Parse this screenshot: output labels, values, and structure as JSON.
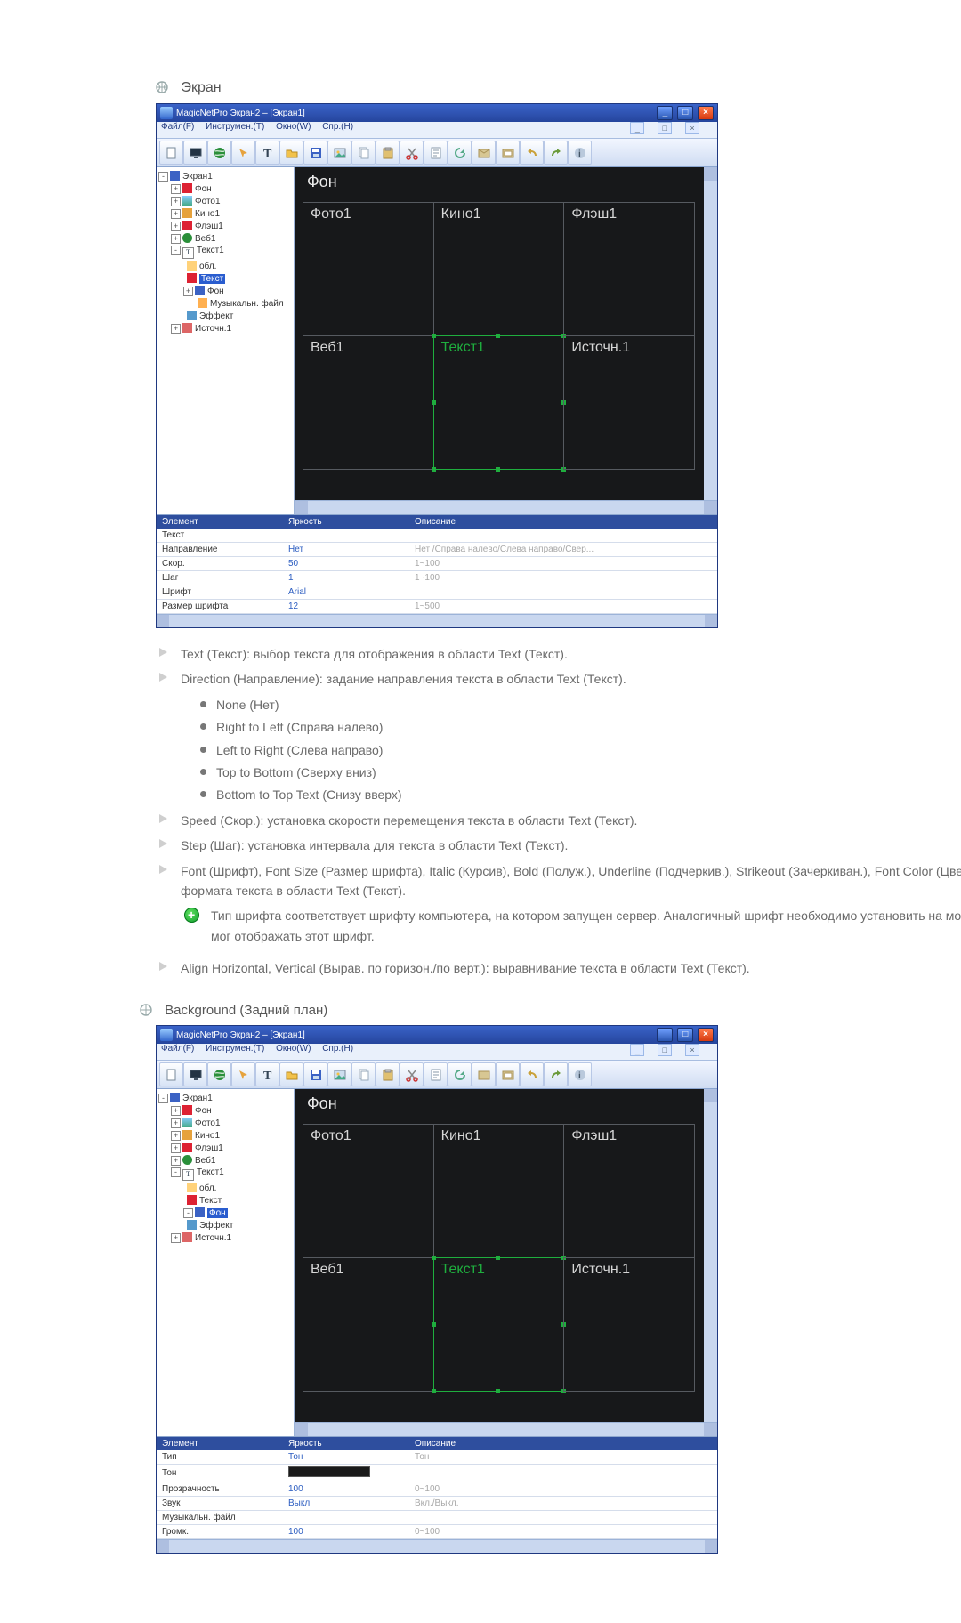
{
  "sections": {
    "screen_heading": "Экран",
    "background_heading": "Background (Задний план)"
  },
  "doc": {
    "text_item": "Text (Текст): выбор текста для отображения в области Text (Текст).",
    "direction_item": "Direction (Направление): задание направления текста в области Text (Текст).",
    "direction_opts": [
      "None (Нет)",
      "Right to Left (Справа налево)",
      "Left to Right (Слева направо)",
      "Top to Bottom (Сверху вниз)",
      "Bottom to Top Text (Снизу вверх)"
    ],
    "speed_item": "Speed (Скор.): установка скорости перемещения текста в области Text (Текст).",
    "step_item": "Step (Шаг): установка интервала для текста в области Text (Текст).",
    "font_item": "Font (Шрифт), Font Size (Размер шрифта), Italic (Курсив), Bold (Полуж.), Underline (Подчеркив.), Strikeout (Зачеркиван.), Font Color (Цвет шрифта): задание формата текста в области Text (Текст).",
    "font_note": "Тип шрифта соответствует шрифту компьютера, на котором запущен сервер. Аналогичный шрифт необходимо установить на мониторе, чтобы он мог отображать этот шрифт.",
    "align_item": "Align Horizontal, Vertical (Вырав. по горизон./по верт.): выравнивание текста в области Text (Текст)."
  },
  "app": {
    "title_outer": "MagicNetPro Экран2 – [Экран1]",
    "title_inner": "Экран",
    "menu": {
      "file": "Файл(F)",
      "tools": "Инструмен.(T)",
      "window": "Окно(W)",
      "help": "Спр.(H)"
    }
  },
  "tree": {
    "root": "Экран1",
    "bg": "Фон",
    "photo": "Фото1",
    "movie": "Кино1",
    "flash": "Флэш1",
    "web": "Веб1",
    "text": "Текст1",
    "text_area": "обл.",
    "text_text": "Текст",
    "text_bg": "Фон",
    "text_music": "Музыкальн. файл",
    "text_effect": "Эффект",
    "source": "Источн.1"
  },
  "canvas": {
    "bg": "Фон",
    "cells": [
      "Фото1",
      "Кино1",
      "Флэш1",
      "Веб1",
      "Текст1",
      "Источн.1"
    ]
  },
  "props_text": {
    "headers": {
      "element": "Элемент",
      "value": "Яркость",
      "desc": "Описание"
    },
    "rows": [
      {
        "k": "Текст",
        "v": "",
        "d": ""
      },
      {
        "k": "Направление",
        "v": "Нет",
        "d": "Нет /Справа налево/Слева направо/Свер..."
      },
      {
        "k": "Скор.",
        "v": "50",
        "d": "1~100"
      },
      {
        "k": "Шаг",
        "v": "1",
        "d": "1~100"
      },
      {
        "k": "Шрифт",
        "v": "Arial",
        "d": ""
      },
      {
        "k": "Размер шрифта",
        "v": "12",
        "d": "1~500"
      }
    ]
  },
  "props_bg": {
    "headers": {
      "element": "Элемент",
      "value": "Яркость",
      "desc": "Описание"
    },
    "rows": [
      {
        "k": "Тип",
        "v": "Тон",
        "d": "Тон"
      },
      {
        "k": "Тон",
        "v": "__bar__",
        "d": ""
      },
      {
        "k": "Прозрачность",
        "v": "100",
        "d": "0~100"
      },
      {
        "k": "Звук",
        "v": "Выкл.",
        "d": "Вкл./Выкл."
      },
      {
        "k": "Музыкальн. файл",
        "v": "",
        "d": ""
      },
      {
        "k": "Громк.",
        "v": "100",
        "d": "0~100"
      }
    ]
  }
}
